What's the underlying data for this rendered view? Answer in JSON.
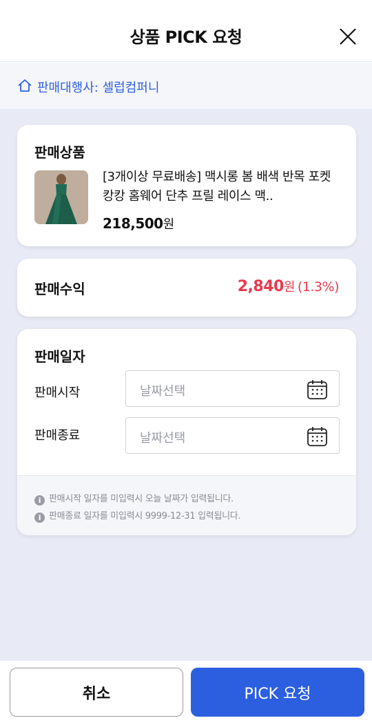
{
  "header": {
    "title": "상품 PICK 요청"
  },
  "agency": {
    "label": "판매대행사: 셀럽컴퍼니"
  },
  "product": {
    "section_title": "판매상품",
    "name": "[3개이상 무료배송] 맥시롱 봄 배색 반목 포켓 캉캉 홈웨어 단추 프릴 레이스 맥..",
    "price": "218,500",
    "price_unit": "원"
  },
  "profit": {
    "label": "판매수익",
    "amount": "2,840",
    "unit": "원",
    "rate": "(1.3%)"
  },
  "sales_period": {
    "section_title": "판매일자",
    "start_label": "판매시작",
    "start_placeholder": "날짜선택",
    "end_label": "판매종료",
    "end_placeholder": "날짜선택",
    "notices": [
      "판매시작 일자를 미입력시 오늘 날짜가 입력됩니다.",
      "판매종료 일자를 미입력시 9999-12-31 입력됩니다."
    ]
  },
  "buttons": {
    "cancel": "취소",
    "submit": "PICK 요청"
  },
  "colors": {
    "accent": "#2c5fe0",
    "profit": "#e8394d",
    "background": "#e8eaf6"
  }
}
